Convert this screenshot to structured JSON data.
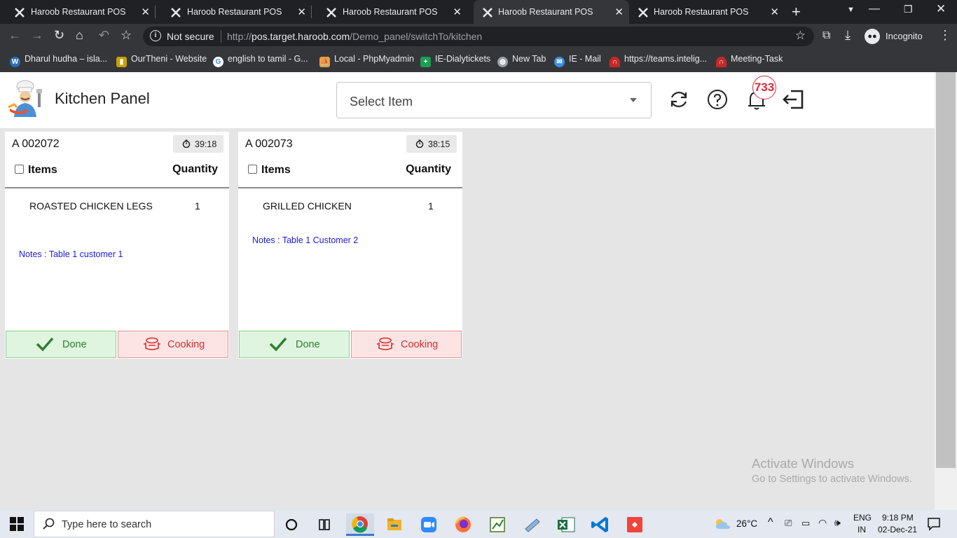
{
  "browser": {
    "tabs": [
      {
        "title": "Haroob Restaurant POS",
        "active": false
      },
      {
        "title": "Haroob Restaurant POS",
        "active": false
      },
      {
        "title": "Haroob Restaurant POS",
        "active": false
      },
      {
        "title": "Haroob Restaurant POS",
        "active": true
      },
      {
        "title": "Haroob Restaurant POS",
        "active": false
      }
    ],
    "security_label": "Not secure",
    "url_prefix": "http://",
    "url_host": "pos.target.haroob.com",
    "url_path": "/Demo_panel/switchTo/kitchen",
    "profile_label": "Incognito",
    "bookmarks": [
      {
        "label": "Dharul hudha – isla...",
        "icon": "wordpress-icon",
        "color": "#2b6fb5"
      },
      {
        "label": "OurTheni - Website",
        "icon": "chart-icon",
        "color": "#c9a100"
      },
      {
        "label": "english to tamil - G...",
        "icon": "google-icon",
        "color": "#4285f4"
      },
      {
        "label": "Local - PhpMyadmin",
        "icon": "phpmyadmin-icon",
        "color": "#e8a33a"
      },
      {
        "label": "IE-Dialytickets",
        "icon": "sheets-icon",
        "color": "#1e9e53"
      },
      {
        "label": "New Tab",
        "icon": "globe-icon",
        "color": "#9aa0a6"
      },
      {
        "label": "IE - Mail",
        "icon": "mail-icon",
        "color": "#3a8ee6"
      },
      {
        "label": "https://teams.intelig...",
        "icon": "teams-icon",
        "color": "#c62828"
      },
      {
        "label": "Meeting-Task",
        "icon": "meeting-icon",
        "color": "#c62828"
      }
    ]
  },
  "app": {
    "title": "Kitchen Panel",
    "select_placeholder": "Select Item",
    "notification_count": "733"
  },
  "orders": [
    {
      "order_no": "A 002072",
      "timer": "39:18",
      "items_header": "Items",
      "qty_header": "Quantity",
      "items": [
        {
          "name": "ROASTED CHICKEN LEGS",
          "qty": "1"
        }
      ],
      "notes": "Notes : Table 1 customer 1",
      "done_label": "Done",
      "cooking_label": "Cooking"
    },
    {
      "order_no": "A 002073",
      "timer": "38:15",
      "items_header": "Items",
      "qty_header": "Quantity",
      "items": [
        {
          "name": "GRILLED CHICKEN",
          "qty": "1"
        }
      ],
      "notes": "Notes : Table 1 Customer 2",
      "done_label": "Done",
      "cooking_label": "Cooking"
    }
  ],
  "watermark": {
    "line1": "Activate Windows",
    "line2": "Go to Settings to activate Windows."
  },
  "taskbar": {
    "search_placeholder": "Type here to search",
    "weather": "26°C",
    "lang_top": "ENG",
    "lang_bottom": "IN",
    "time": "9:18 PM",
    "date": "02-Dec-21"
  }
}
